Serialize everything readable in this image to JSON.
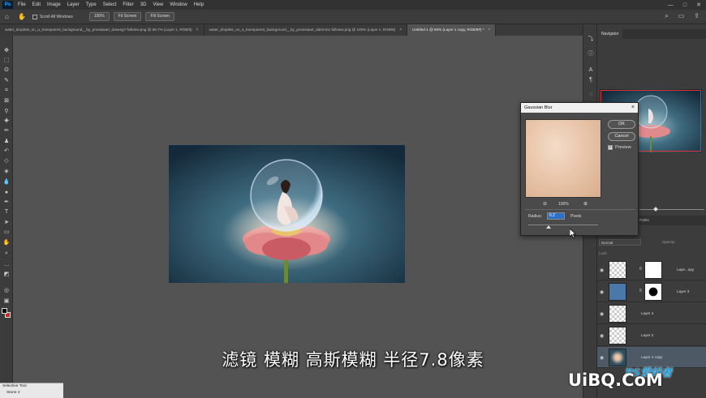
{
  "menubar": {
    "logo": "Ps",
    "items": [
      "File",
      "Edit",
      "Image",
      "Layer",
      "Type",
      "Select",
      "Filter",
      "3D",
      "View",
      "Window",
      "Help"
    ],
    "window_controls": [
      "—",
      "□",
      "✕"
    ]
  },
  "options": {
    "scroll_all_label": "Scroll All Windows",
    "zoom_btn": "100%",
    "fit_btn": "Fit Screen",
    "fill_btn": "Fill Screen"
  },
  "tabs": [
    {
      "label": "water_droplets_on_a_transparent_background__by_pnossiaart_daseeg7-fullview.png @ 66.7% (Layer 1, RGB/8)",
      "active": false
    },
    {
      "label": "water_droplets_on_a_transparent_background__by_pnossiaart_dabmm1-fullview.png @ 100% (Layer 1, RGB/8)",
      "active": false
    },
    {
      "label": "Untitled-1 @ 50% (Layer 1 copy, RGB/8#) *",
      "active": true
    }
  ],
  "navigator": {
    "tab": "Navigator"
  },
  "layers": {
    "tab_label": "Paths",
    "blend_mode": "Normal",
    "opacity_label": "Opacity:",
    "lock_label": "Lock:",
    "rows": [
      {
        "name": "Laye...opy",
        "has_mask": true,
        "selected": false
      },
      {
        "name": "Layer 3",
        "has_mask": true,
        "selected": false
      },
      {
        "name": "Layer 4",
        "has_mask": false,
        "selected": false
      },
      {
        "name": "Layer 2",
        "has_mask": false,
        "selected": false
      },
      {
        "name": "Layer 1 copy",
        "has_mask": false,
        "selected": true
      }
    ]
  },
  "dialog": {
    "title": "Gaussian Blur",
    "ok_label": "OK",
    "cancel_label": "Cancel",
    "preview_label": "Preview",
    "preview_checked": true,
    "zoom_percent": "100%",
    "radius_label": "Radius:",
    "radius_value": "6.2",
    "radius_unit": "Pixels"
  },
  "caption": "滤镜 模糊 高斯模糊 半径7.8像素",
  "watermark": {
    "main": "UiBQ.CoM",
    "sub": "PS爱好者"
  },
  "mini_panel": {
    "title": "Selective Tool",
    "body": "Stone 2"
  },
  "colors": {
    "foreground": "#000000",
    "background": "#e02020",
    "accent_selection": "#2d6fc4"
  },
  "icons": {
    "home": "⌂",
    "hand": "✋",
    "search": "⌕",
    "workspace": "▭",
    "share": "⇪"
  }
}
